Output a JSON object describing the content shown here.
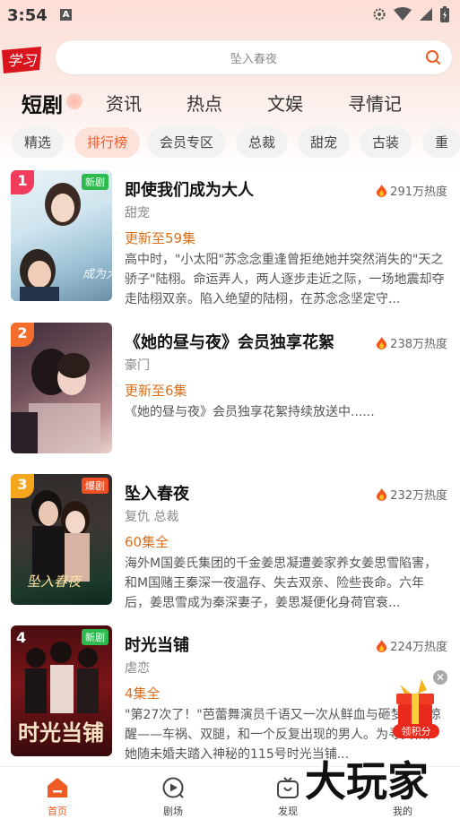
{
  "status_bar": {
    "time": "3:54",
    "notification_icon": "A"
  },
  "header": {
    "logo_text": "学习",
    "search_placeholder": "坠入春夜"
  },
  "tabs": [
    {
      "label": "短剧",
      "active": true
    },
    {
      "label": "资讯"
    },
    {
      "label": "热点"
    },
    {
      "label": "文娱"
    },
    {
      "label": "寻情记"
    }
  ],
  "chips": [
    {
      "label": "精选"
    },
    {
      "label": "排行榜",
      "active": true
    },
    {
      "label": "会员专区"
    },
    {
      "label": "总裁"
    },
    {
      "label": "甜宠"
    },
    {
      "label": "古装"
    },
    {
      "label": "重生"
    }
  ],
  "items": [
    {
      "rank": "1",
      "badge": "新剧",
      "title": "即使我们成为大人",
      "heat": "291万热度",
      "genre": "甜宠",
      "episodes": "更新至59集",
      "desc": "高中时，\"小太阳\"苏念念重逢曾拒绝她并突然消失的\"天之骄子\"陆栩。命运弄人，两人逐步走近之际，一场地震却夺走陆栩双亲。陷入绝望的陆栩，在苏念念坚定守..."
    },
    {
      "rank": "2",
      "badge": "",
      "title": "《她的昼与夜》会员独享花絮",
      "heat": "238万热度",
      "genre": "豪门",
      "episodes": "更新至6集",
      "desc": "《她的昼与夜》会员独享花絮持续放送中......"
    },
    {
      "rank": "3",
      "badge": "爆剧",
      "title": "坠入春夜",
      "heat": "232万热度",
      "genre": "复仇 总裁",
      "episodes": "60集全",
      "desc": "海外M国姜氏集团的千金姜思凝遭姜家养女姜思雪陷害，和M国赌王秦深一夜温存、失去双亲、险些丧命。六年后，姜思雪成为秦深妻子，姜思凝便化身荷官衰..."
    },
    {
      "rank": "4",
      "badge": "新剧",
      "title": "时光当铺",
      "heat": "224万热度",
      "genre": "虐恋",
      "episodes": "4集全",
      "desc": "\"第27次了！\"芭蕾舞演员千语又一次从鲜血与砸梦境中惊醒——车祸、双腿，和一个反复出现的男人。为寻真相，她随未婚夫踏入神秘的115号时光当铺..."
    }
  ],
  "float_reward": {
    "label": "领积分",
    "close": "✕"
  },
  "bottom_nav": [
    {
      "label": "首页",
      "active": true
    },
    {
      "label": "剧场"
    },
    {
      "label": "发现"
    },
    {
      "label": "我的"
    }
  ],
  "watermark": "大玩家",
  "colors": {
    "accent": "#f05a24",
    "episode": "#d77020",
    "rank1": "#ef3d5b",
    "rank2": "#f36d2c",
    "rank3": "#f6a61c"
  }
}
